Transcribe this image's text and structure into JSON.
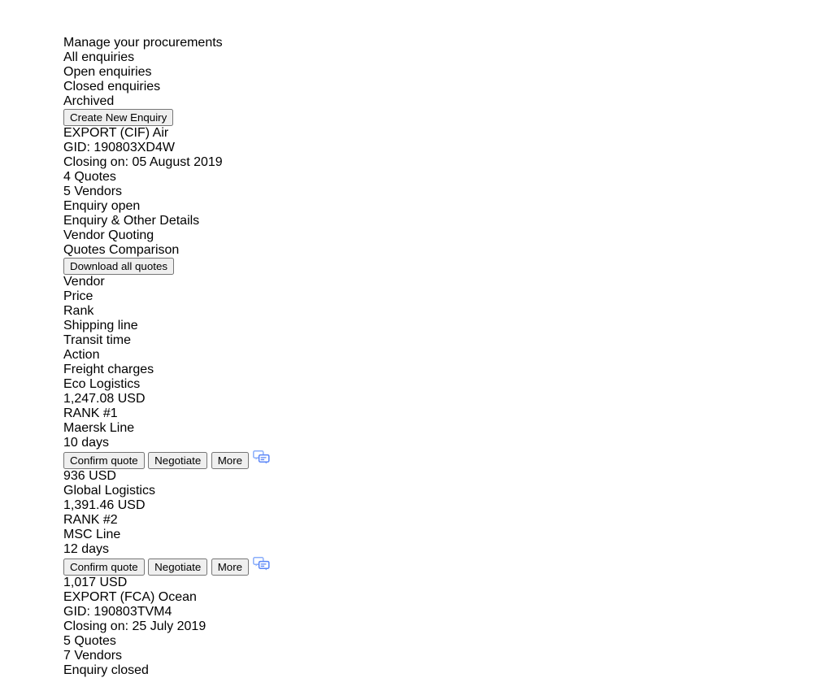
{
  "window": {
    "traffic_lights": [
      "close-red",
      "minimize-yellow",
      "maximize-green"
    ]
  },
  "header": {
    "title": "Manage your procurements",
    "tabs": [
      {
        "label": "All enquiries",
        "active": true
      },
      {
        "label": "Open enquiries",
        "active": false
      },
      {
        "label": "Closed enquiries",
        "active": false
      },
      {
        "label": "Archived",
        "active": false
      }
    ],
    "create_button": "Create New Enquiry"
  },
  "enquiries": [
    {
      "type": "EXPORT (CIF) Air",
      "gid": "GID: 190803XD4W",
      "closing": "Closing on: 05 August 2019",
      "quotes": "4 Quotes",
      "vendors": "5 Vendors",
      "status": "Enquiry open",
      "status_color": "#2fc05a",
      "expanded": true,
      "chevron": "chevron-up-icon"
    },
    {
      "type": "EXPORT (FCA) Ocean",
      "gid": "GID: 190803TVM4",
      "closing": "Closing on: 25 July 2019",
      "quotes": "5 Quotes",
      "vendors": "7 Vendors",
      "status": "Enquiry closed",
      "status_color": "#f7a62a",
      "expanded": false,
      "chevron": "chevron-down-icon"
    }
  ],
  "subtabs": [
    {
      "label": "Enquiry & Other Details",
      "active": false
    },
    {
      "label": "Vendor Quoting",
      "active": false
    },
    {
      "label": "Quotes Comparison",
      "active": true
    }
  ],
  "download_button": "Download all quotes",
  "comparison": {
    "labels": [
      "Vendor",
      "Price",
      "Rank",
      "Shipping line",
      "Transit time",
      "Action",
      "Freight charges"
    ],
    "vendors": [
      {
        "name": "Eco Logistics",
        "price": "1,247.08 USD",
        "rank": "RANK #1",
        "shipping_line": "Maersk Line",
        "transit_time": "10 days",
        "freight_charges": "936 USD",
        "actions": {
          "confirm": "Confirm quote",
          "negotiate": "Negotiate",
          "more": "More",
          "chat": "chat-icon"
        }
      },
      {
        "name": "Global Logistics",
        "price": "1,391.46 USD",
        "rank": "RANK #2",
        "shipping_line": "MSC Line",
        "transit_time": "12 days",
        "freight_charges": "1,017 USD",
        "actions": {
          "confirm": "Confirm quote",
          "negotiate": "Negotiate",
          "more": "More",
          "chat": "chat-icon"
        }
      }
    ]
  },
  "colors": {
    "primary_blue": "#1d54f2",
    "accent_blue": "#2563f0",
    "amber": "#fcbf1e",
    "green": "#2fc05a",
    "orange": "#f7a62a",
    "titlebar": "#d7dce1"
  }
}
